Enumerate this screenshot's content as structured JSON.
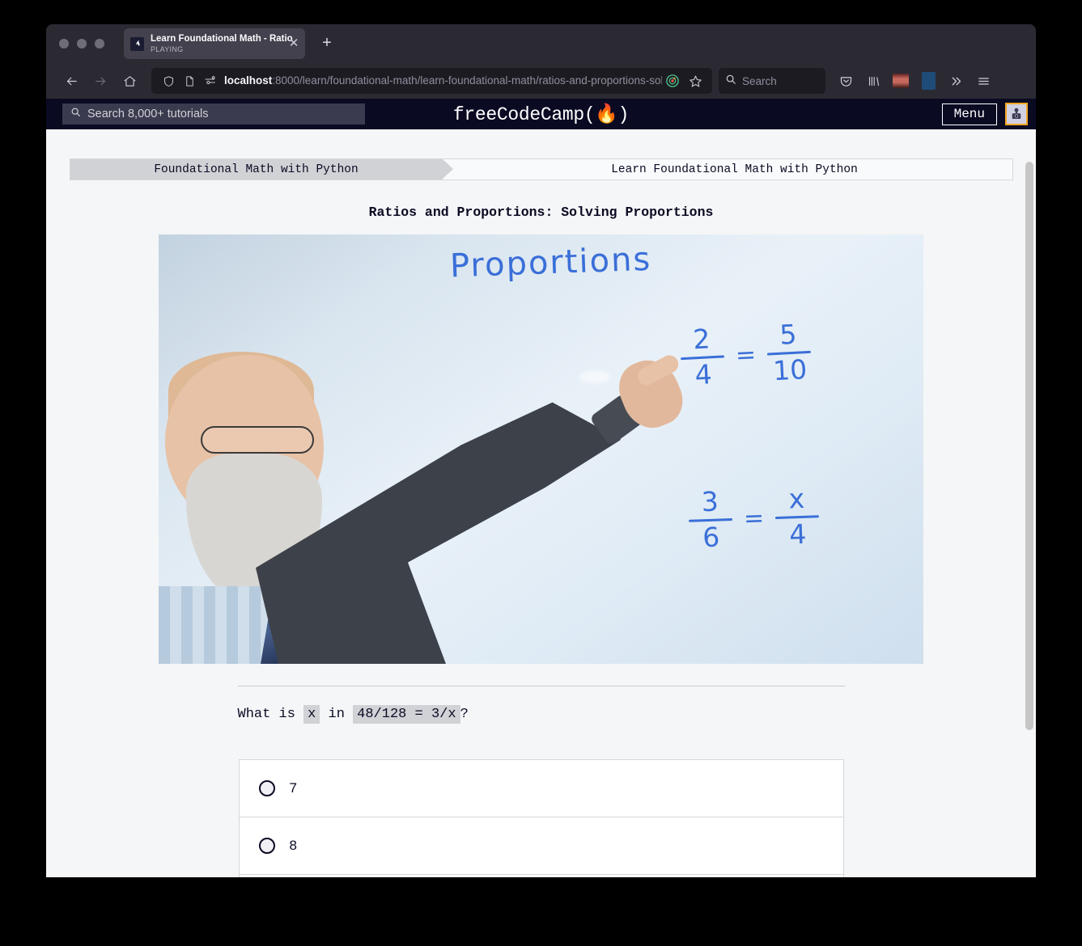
{
  "browser": {
    "tab": {
      "title": "Learn Foundational Math - Ratio",
      "status": "PLAYING",
      "close_label": "✕",
      "favicon_name": "freecodecamp-favicon"
    },
    "new_tab_label": "+",
    "nav": {
      "back_label": "←",
      "forward_label": "→",
      "home_label": "⌂"
    },
    "url": {
      "host": "localhost",
      "path": ":8000/learn/foundational-math/learn-foundational-math/ratios-and-proportions-solv"
    },
    "search": {
      "placeholder": "Search"
    }
  },
  "site_header": {
    "search_placeholder": "Search 8,000+ tutorials",
    "logo_text": "freeCodeCamp(🔥)",
    "logo_name": "freeCodeCamp",
    "menu_label": "Menu",
    "avatar_name": "user-avatar"
  },
  "breadcrumb": {
    "superblock": "Foundational Math with Python",
    "block": "Learn Foundational Math with Python"
  },
  "lesson": {
    "title": "Ratios and Proportions: Solving Proportions",
    "video": {
      "whiteboard_title": "Proportions",
      "equation_1": {
        "left_num": "2",
        "left_den": "4",
        "operator": "=",
        "right_num": "5",
        "right_den": "10"
      },
      "equation_2": {
        "left_num": "3",
        "left_den": "6",
        "operator": "=",
        "right_num": "x",
        "right_den": "4"
      }
    },
    "question": {
      "prefix": "What is ",
      "variable": "x",
      "middle": " in ",
      "expression": "48/128 = 3/x",
      "suffix": "?"
    },
    "answers": [
      {
        "label": "7",
        "selected": false
      },
      {
        "label": "8",
        "selected": false
      },
      {
        "label": "",
        "selected": false
      }
    ]
  }
}
